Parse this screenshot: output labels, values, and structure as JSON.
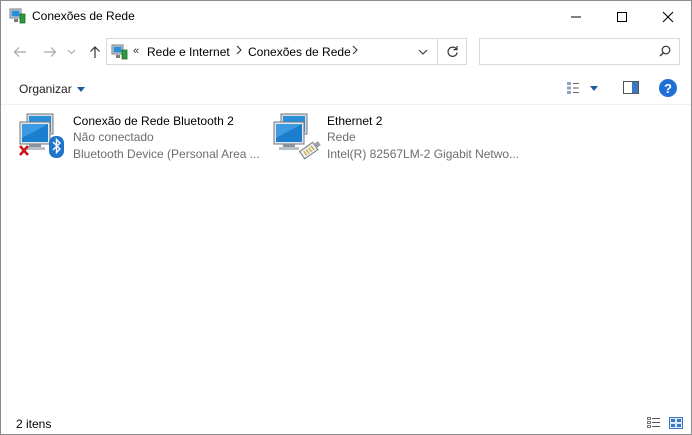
{
  "window": {
    "title": "Conexões de Rede",
    "title_icon": "network-connections-icon"
  },
  "nav": {
    "back_icon": "arrow-left-icon",
    "forward_icon": "arrow-right-icon",
    "recent_icon": "chevron-down-icon",
    "up_icon": "arrow-up-icon",
    "overflow": "«",
    "breadcrumbs": [
      "Rede e Internet",
      "Conexões de Rede"
    ],
    "crumb_separator": ">",
    "refresh_icon": "refresh-icon",
    "search_placeholder": "",
    "search_icon": "search-icon"
  },
  "commands": {
    "organize_label": "Organizar",
    "view_icon": "view-options-icon",
    "preview_pane_icon": "preview-pane-icon",
    "help_label": "?"
  },
  "items": [
    {
      "name": "Conexão de Rede Bluetooth 2",
      "status": "Não conectado",
      "device": "Bluetooth Device (Personal Area ...",
      "icon": "bluetooth-network-disconnected-icon"
    },
    {
      "name": "Ethernet 2",
      "status": "Rede",
      "device": "Intel(R) 82567LM-2 Gigabit Netwo...",
      "icon": "ethernet-network-icon"
    }
  ],
  "statusbar": {
    "item_count": "2 itens",
    "details_view_icon": "details-view-icon",
    "large_icons_view_icon": "large-icons-view-icon"
  },
  "colors": {
    "accent": "#1f6fd6",
    "help_bg": "#1f6fd6",
    "error_x": "#d0121a",
    "bluetooth_bg": "#1e74c8"
  }
}
